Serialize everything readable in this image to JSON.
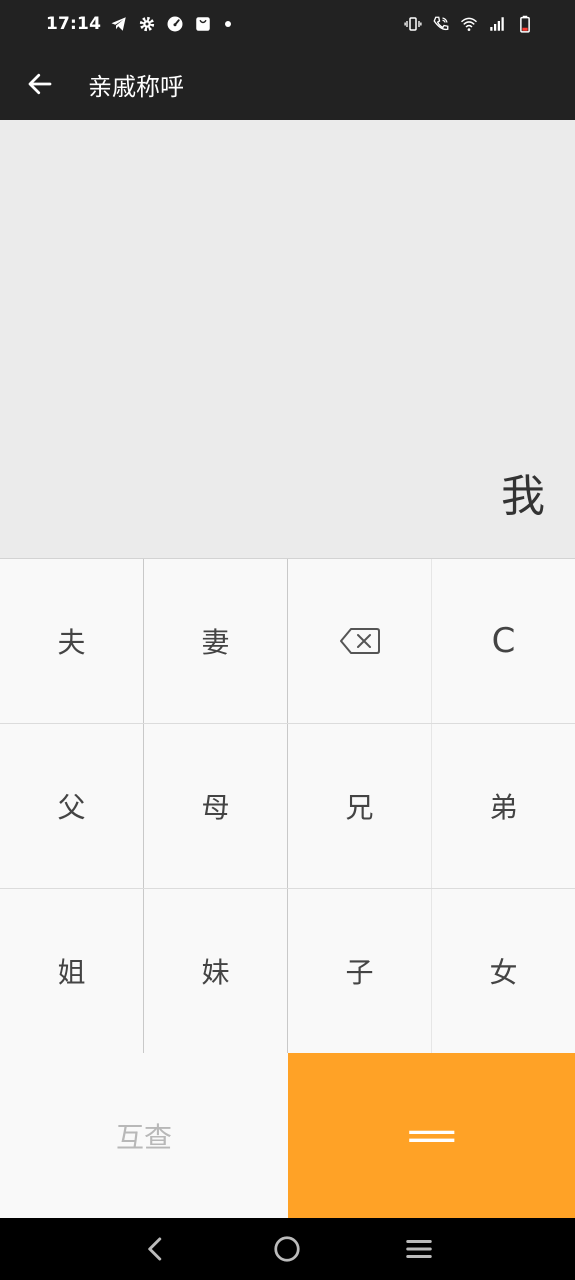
{
  "status_bar": {
    "time": "17:14"
  },
  "app_bar": {
    "title": "亲戚称呼"
  },
  "display": {
    "result": "我"
  },
  "keypad": {
    "row1": [
      "夫",
      "妻",
      "",
      "C"
    ],
    "row2": [
      "父",
      "母",
      "兄",
      "弟"
    ],
    "row3": [
      "姐",
      "妹",
      "子",
      "女"
    ],
    "mutual_label": "互查",
    "equals_label": "="
  },
  "icons": {
    "back": "arrow-left-icon",
    "backspace": "backspace-icon",
    "nav_back": "chevron-left-icon",
    "nav_home": "circle-home-icon",
    "nav_menu": "menu-icon"
  },
  "colors": {
    "header_bg": "#222222",
    "display_bg": "#ebebeb",
    "keypad_bg": "#f9f9f9",
    "accent": "#ffa226"
  }
}
